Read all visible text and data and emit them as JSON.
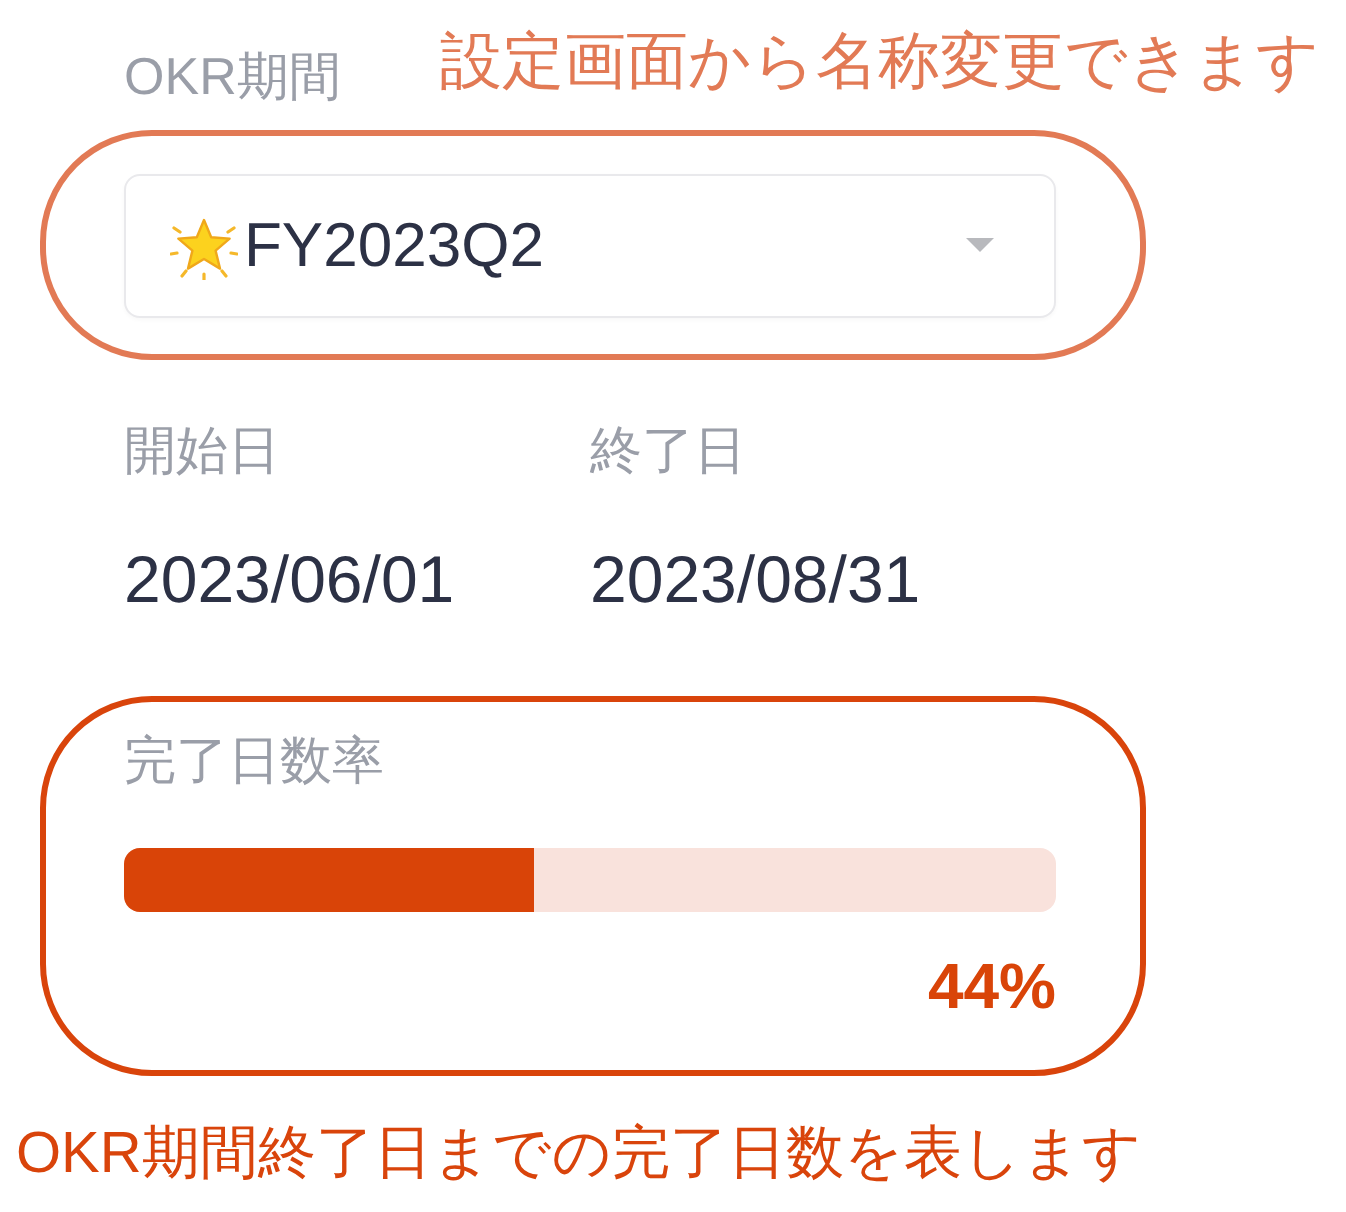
{
  "okr_period": {
    "label": "OKR期間",
    "value": "FY2023Q2"
  },
  "dates": [
    {
      "label": "開始日",
      "value": "2023/06/01"
    },
    {
      "label": "終了日",
      "value": "2023/08/31"
    }
  ],
  "completion": {
    "label": "完了日数率",
    "level": 0.44,
    "reading": "44%"
  },
  "callouts": [
    {
      "text": "設定画面から名称変更できます",
      "color": "#e27a55"
    },
    {
      "text": "OKR期間終了日までの完了日数を表します",
      "color": "#d9440b"
    }
  ]
}
